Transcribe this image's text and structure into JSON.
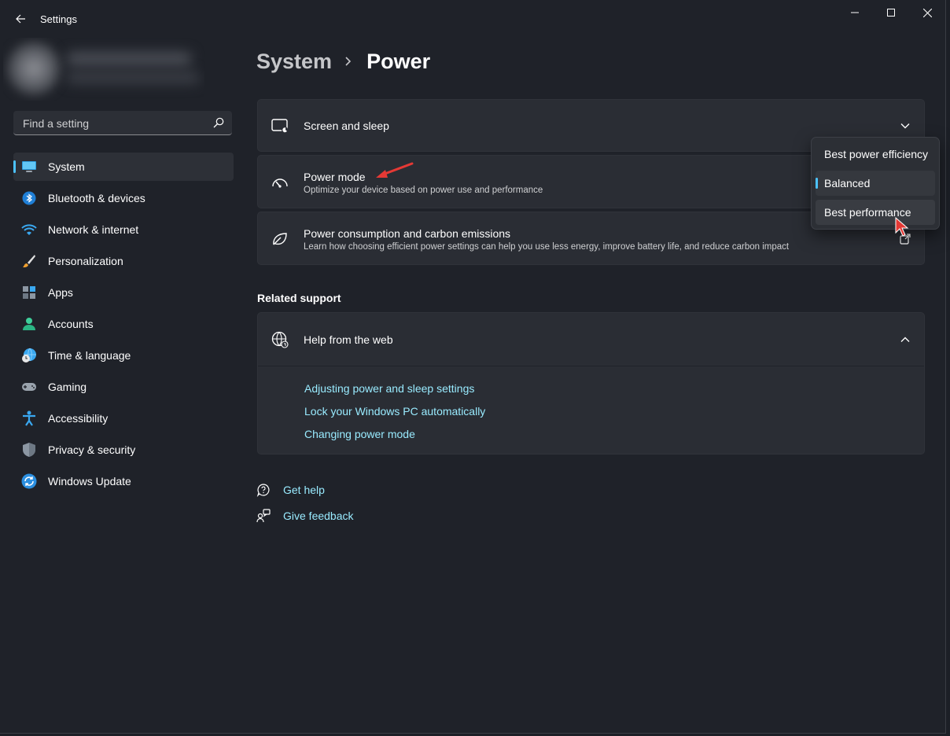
{
  "window": {
    "title": "Settings"
  },
  "search": {
    "placeholder": "Find a setting"
  },
  "sidebar": {
    "items": [
      {
        "label": "System",
        "icon": "monitor-icon",
        "active": true
      },
      {
        "label": "Bluetooth & devices",
        "icon": "bluetooth-icon"
      },
      {
        "label": "Network & internet",
        "icon": "wifi-icon"
      },
      {
        "label": "Personalization",
        "icon": "brush-icon"
      },
      {
        "label": "Apps",
        "icon": "apps-icon"
      },
      {
        "label": "Accounts",
        "icon": "person-icon"
      },
      {
        "label": "Time & language",
        "icon": "globe-clock-icon"
      },
      {
        "label": "Gaming",
        "icon": "gamepad-icon"
      },
      {
        "label": "Accessibility",
        "icon": "accessibility-icon"
      },
      {
        "label": "Privacy & security",
        "icon": "shield-icon"
      },
      {
        "label": "Windows Update",
        "icon": "update-icon"
      }
    ]
  },
  "breadcrumb": {
    "parent": "System",
    "current": "Power"
  },
  "cards": {
    "screen_sleep": {
      "title": "Screen and sleep"
    },
    "power_mode": {
      "title": "Power mode",
      "subtitle": "Optimize your device based on power use and performance"
    },
    "consumption": {
      "title": "Power consumption and carbon emissions",
      "subtitle": "Learn how choosing efficient power settings can help you use less energy, improve battery life, and reduce carbon impact"
    }
  },
  "power_mode_dropdown": {
    "options": [
      "Best power efficiency",
      "Balanced",
      "Best performance"
    ],
    "selected": "Balanced",
    "hovered": "Best performance"
  },
  "related_support": {
    "title": "Related support",
    "help_card_title": "Help from the web",
    "links": [
      "Adjusting power and sleep settings",
      "Lock your Windows PC automatically",
      "Changing power mode"
    ]
  },
  "footer": {
    "get_help": "Get help",
    "give_feedback": "Give feedback"
  },
  "colors": {
    "accent": "#4cc2ff",
    "link": "#99ebff",
    "annotation": "#e53935"
  }
}
